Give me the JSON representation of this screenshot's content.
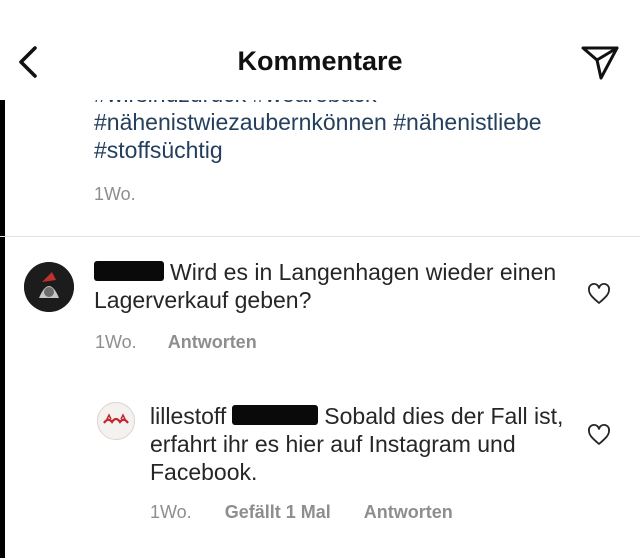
{
  "header": {
    "title": "Kommentare",
    "back_icon": "chevron-left-icon",
    "send_icon": "paper-plane-icon"
  },
  "caption": {
    "hashtag_cut": "#wirsindzurück #weareback",
    "hashtags": [
      "#nähenistwiezaubernkönnen",
      "#nähenistliebe",
      "#stoffsüchtig"
    ],
    "time": "1Wo."
  },
  "comments": [
    {
      "text": "Wird es in Langenhagen wieder einen Lagerverkauf geben?",
      "time": "1Wo.",
      "reply_label": "Antworten"
    },
    {
      "username": "lillestoff",
      "text": "Sobald dies der Fall ist, erfahrt ihr es hier auf Instagram und Facebook.",
      "time": "1Wo.",
      "likes_label": "Gefällt 1 Mal",
      "reply_label": "Antworten"
    }
  ],
  "colors": {
    "hashtag": "#24405e",
    "meta": "#8e8e8e",
    "text": "#262626",
    "redaction": "#0a0a0a"
  }
}
